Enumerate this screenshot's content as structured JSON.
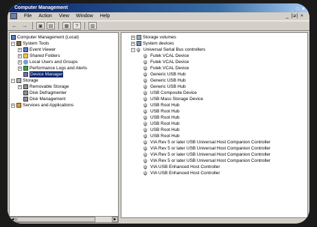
{
  "window": {
    "title": "Computer Management",
    "controls": "_ □ ×"
  },
  "menu": {
    "items": [
      "File",
      "Action",
      "View",
      "Window",
      "Help"
    ],
    "mdi_controls": "_ |ə| ×"
  },
  "toolbar": {
    "buttons": [
      "back-icon",
      "forward-icon",
      "up-icon",
      "properties-icon",
      "print-icon",
      "help-icon",
      "refresh-icon"
    ]
  },
  "tree": {
    "root": "Computer Management (Local)",
    "system_tools": "System Tools",
    "event_viewer": "Event Viewer",
    "shared_folders": "Shared Folders",
    "local_users": "Local Users and Groups",
    "perf_logs": "Performance Logs and Alerts",
    "device_manager": "Device Manager",
    "storage": "Storage",
    "removable": "Removable Storage",
    "defrag": "Disk Defragmenter",
    "disk_mgmt": "Disk Management",
    "services": "Services and Applications"
  },
  "devices": {
    "storage_volumes": "Storage volumes",
    "system_devices": "System devices",
    "usb_controllers": "Universal Serial Bus controllers",
    "items": [
      "Futek VCAL Device",
      "Futek VCAL Device",
      "Futek VCAL Device",
      "Generic USB Hub",
      "Generic USB Hub",
      "Generic USB Hub",
      "USB Composite Device",
      "USB Mass Storage Device",
      "USB Root Hub",
      "USB Root Hub",
      "USB Root Hub",
      "USB Root Hub",
      "USB Root Hub",
      "USB Root Hub",
      "VIA Rev 5 or later USB Universal Host Companion Controller",
      "VIA Rev 5 or later USB Universal Host Companion Controller",
      "VIA Rev 5 or later USB Universal Host Companion Controller",
      "VIA Rev 5 or later USB Universal Host Companion Controller",
      "VIA USB Enhanced Host Controller",
      "VIA USB Enhanced Host Controller"
    ]
  }
}
